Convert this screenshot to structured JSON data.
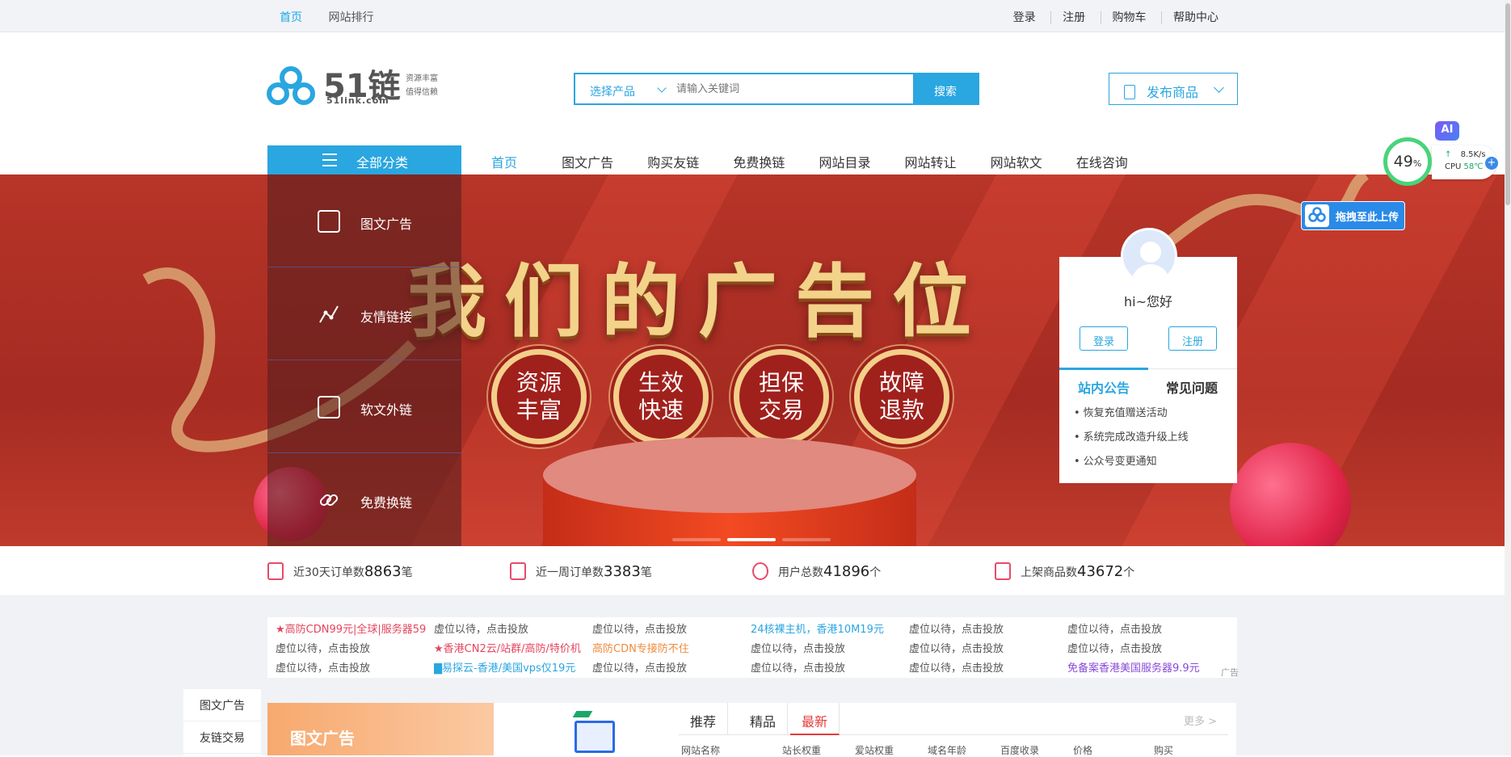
{
  "topbar": {
    "left": [
      "首页",
      "网站排行"
    ],
    "right": [
      "登录",
      "注册",
      "购物车",
      "帮助中心"
    ]
  },
  "logo": {
    "text": "51链",
    "sub": "51link.com",
    "slogan1": "资源丰富",
    "slogan2": "值得信赖"
  },
  "search": {
    "select_label": "选择产品",
    "placeholder": "请输入关键词",
    "button": "搜索"
  },
  "publish": {
    "label": "发布商品"
  },
  "nav": {
    "all_categories": "全部分类",
    "items": [
      "首页",
      "图文广告",
      "购买友链",
      "免费换链",
      "网站目录",
      "网站转让",
      "网站软文",
      "在线咨询"
    ]
  },
  "sidemenu": [
    "图文广告",
    "友情链接",
    "软文外链",
    "免费换链"
  ],
  "banner": {
    "headline": "我们的广告位",
    "badges": [
      [
        "资源",
        "丰富"
      ],
      [
        "生效",
        "快速"
      ],
      [
        "担保",
        "交易"
      ],
      [
        "故障",
        "退款"
      ]
    ]
  },
  "user": {
    "greeting": "hi~您好",
    "login": "登录",
    "register": "注册",
    "tab_notice": "站内公告",
    "tab_faq": "常见问题",
    "notices": [
      "恢复充值赠送活动",
      "系统完成改造升级上线",
      "公众号变更通知"
    ]
  },
  "monitor": {
    "percent": "49",
    "unit": "%",
    "speed": "8.5K/s",
    "cpu_label": "CPU",
    "cpu_temp": "58℃"
  },
  "ai_label": "AI",
  "upload_label": "拖拽至此上传",
  "stats": [
    {
      "label": "近30天订单数",
      "value": "8863",
      "unit": "笔"
    },
    {
      "label": "近一周订单数",
      "value": "3383",
      "unit": "笔"
    },
    {
      "label": "用户总数",
      "value": "41896",
      "unit": "个"
    },
    {
      "label": "上架商品数",
      "value": "43672",
      "unit": "个"
    }
  ],
  "ads": {
    "rows": [
      [
        "★高防CDN99元|全球|服务器59",
        "虚位以待，点击投放",
        "虚位以待，点击投放",
        "24核裸主机，香港10M19元",
        "虚位以待，点击投放",
        "虚位以待，点击投放"
      ],
      [
        "虚位以待，点击投放",
        "★香港CN2云/站群/高防/特价机",
        "高防CDN专接防不住",
        "虚位以待，点击投放",
        "虚位以待，点击投放",
        "虚位以待，点击投放"
      ],
      [
        "虚位以待，点击投放",
        "▇易探云-香港/美国vps仅19元",
        "虚位以待，点击投放",
        "虚位以待，点击投放",
        "虚位以待，点击投放",
        "免备案香港美国服务器9.9元"
      ]
    ],
    "tag": "广告",
    "colors": {
      "0-0": "#e5455e",
      "1-1": "#e5455e",
      "1-2": "#f08a3c",
      "0-3": "#2aa6e0",
      "2-1": "#2aa6e0",
      "2-5": "#8a4ad8"
    }
  },
  "leftcat": [
    "图文广告",
    "友链交易"
  ],
  "promo": {
    "title": "图文广告"
  },
  "panel": {
    "tabs": [
      "推荐",
      "精品",
      "最新"
    ],
    "active_tab": "最新",
    "more": "更多 >",
    "columns": [
      "网站名称",
      "站长权重",
      "爱站权重",
      "域名年龄",
      "百度收录",
      "价格",
      "购买"
    ]
  }
}
